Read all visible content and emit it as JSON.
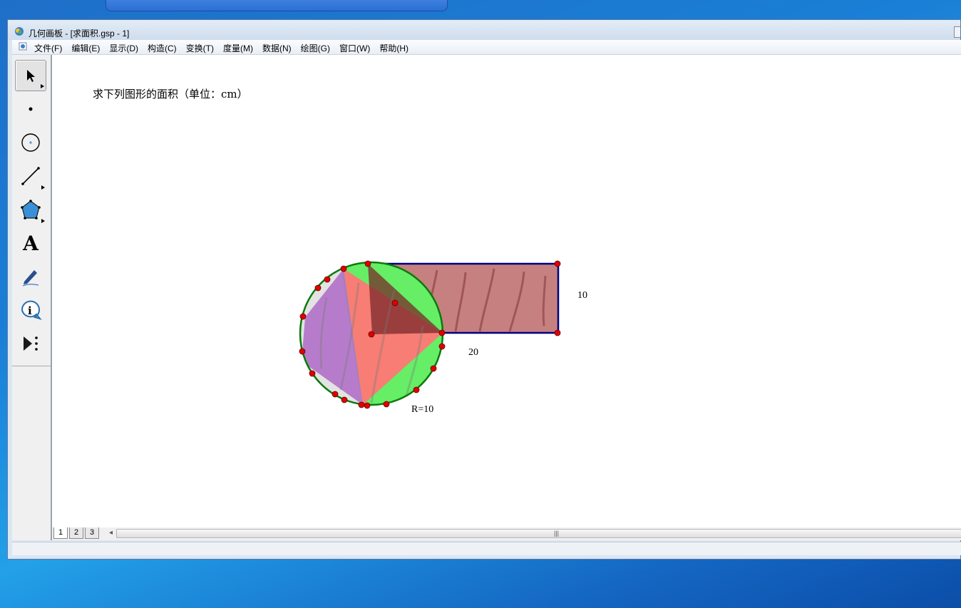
{
  "window": {
    "title": "几何画板 - [求面积.gsp - 1]"
  },
  "menu": {
    "items": [
      "文件(F)",
      "编辑(E)",
      "显示(D)",
      "构造(C)",
      "变换(T)",
      "度量(M)",
      "数据(N)",
      "绘图(G)",
      "窗口(W)",
      "帮助(H)"
    ]
  },
  "toolbox": {
    "tools": [
      "arrow-select-tool",
      "point-tool",
      "compass-tool",
      "straightedge-tool",
      "polygon-tool",
      "text-tool",
      "marker-tool",
      "information-tool",
      "custom-tools"
    ]
  },
  "canvas": {
    "prompt": "求下列图形的面积（单位：cm）",
    "labels": {
      "height": "10",
      "width": "20",
      "radius": "R=10"
    }
  },
  "pages": {
    "tabs": [
      "1",
      "2",
      "3"
    ],
    "active": "1"
  },
  "colors": {
    "circle_stroke": "#0a7a0a",
    "rect_fill": "#b86060",
    "rect_stroke": "#000080",
    "point": "#e00000",
    "green_fill": "#66ee66",
    "purple_fill": "#b070c8",
    "pink_fill": "#ff6b6b"
  }
}
